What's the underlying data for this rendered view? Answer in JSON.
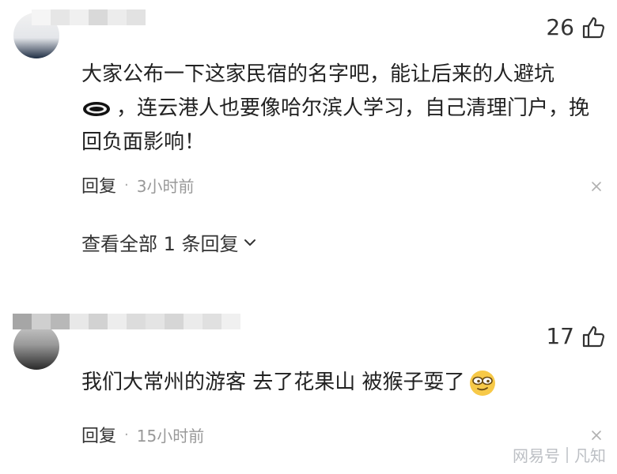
{
  "comments": [
    {
      "likes": "26",
      "text_part1": "大家公布一下这家民宿的名字吧，能让后来的人避坑",
      "text_part2": "，连云港人也要像哈尔滨人学习，自己清理门户，挽回负面影响！",
      "reply_label": "回复",
      "separator": "·",
      "time": "3小时前",
      "view_replies": "查看全部 1 条回复",
      "emoji_icon": "eye-emoji-icon",
      "username_blurred": true
    },
    {
      "likes": "17",
      "text_main": "我们大常州的游客 去了花果山 被猴子耍了",
      "reply_label": "回复",
      "separator": "·",
      "time": "15小时前",
      "emoji_icon": "cool-face-emoji-icon",
      "username_blurred": true
    }
  ],
  "watermark": {
    "platform": "网易号",
    "author": "凡知"
  },
  "colors": {
    "text": "#222222",
    "meta": "#999999",
    "watermark": "#b5b9be"
  }
}
